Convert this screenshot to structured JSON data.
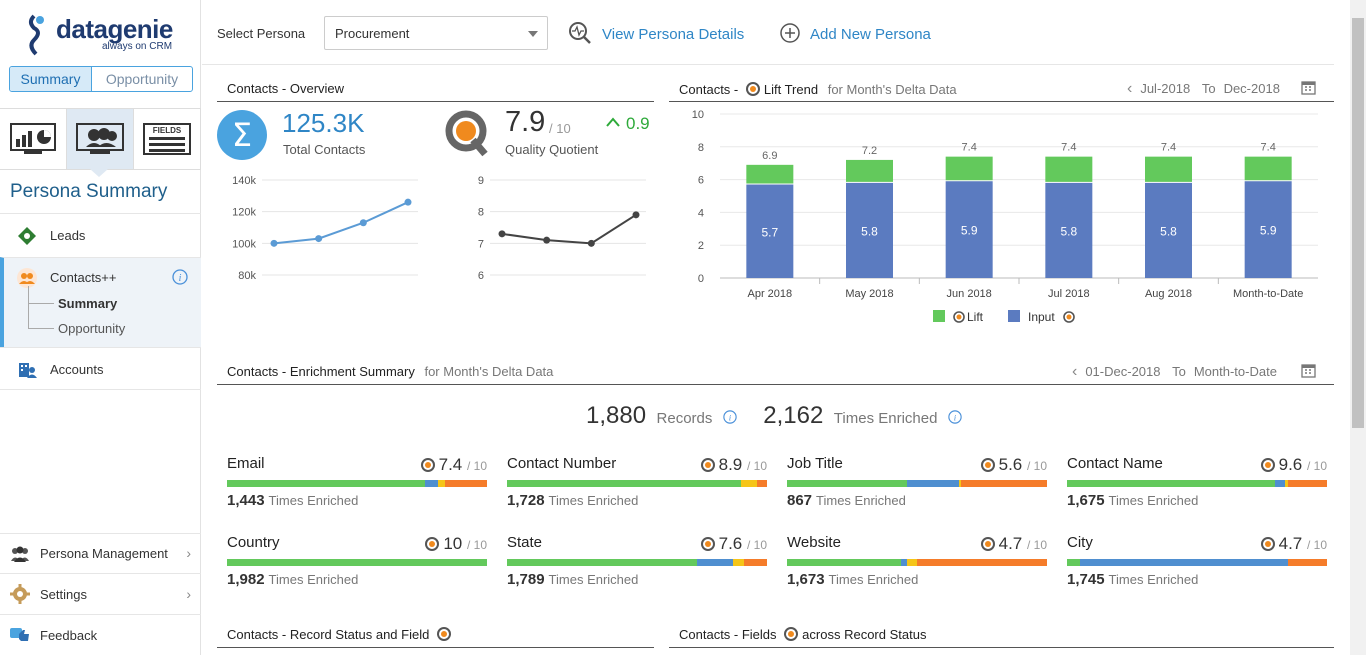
{
  "brand": {
    "name": "datagenie",
    "tagline": "always on CRM"
  },
  "sidebar": {
    "toggle": [
      "Summary",
      "Opportunity"
    ],
    "title": "Persona Summary",
    "items": [
      {
        "label": "Leads"
      },
      {
        "label": "Contacts++",
        "children": [
          "Summary",
          "Opportunity"
        ]
      },
      {
        "label": "Accounts"
      }
    ],
    "bottom": [
      {
        "label": "Persona Management"
      },
      {
        "label": "Settings"
      },
      {
        "label": "Feedback"
      }
    ]
  },
  "header": {
    "select_label": "Select Persona",
    "persona_value": "Procurement",
    "view_details": "View Persona Details",
    "add_persona": "Add New Persona"
  },
  "overview": {
    "title": "Contacts - Overview",
    "total_value": "125.3K",
    "total_label": "Total Contacts",
    "qq_value": "7.9",
    "qq_denom": "/ 10",
    "qq_label": "Quality Quotient",
    "qq_delta": "0.9",
    "contacts_chart": {
      "yticks": [
        "140k",
        "120k",
        "100k",
        "80k"
      ],
      "values": [
        100,
        103,
        113,
        126
      ],
      "ylim": [
        80,
        140
      ]
    },
    "qq_chart": {
      "yticks": [
        "9",
        "8",
        "7",
        "6"
      ],
      "values": [
        7.3,
        7.1,
        7.0,
        7.9
      ],
      "ylim": [
        6,
        9
      ]
    }
  },
  "lift": {
    "title": "Contacts -",
    "title2": "Lift Trend",
    "subtitle": "for Month's Delta Data",
    "from": "Jul-2018",
    "to_word": "To",
    "to": "Dec-2018",
    "legend": [
      "Lift",
      "Input"
    ]
  },
  "chart_data": {
    "type": "bar",
    "categories": [
      "Apr 2018",
      "May 2018",
      "Jun 2018",
      "Jul 2018",
      "Aug 2018",
      "Month-to-Date"
    ],
    "series": [
      {
        "name": "Input",
        "values": [
          5.7,
          5.8,
          5.9,
          5.8,
          5.8,
          5.9
        ]
      },
      {
        "name": "Lift",
        "values": [
          1.2,
          1.4,
          1.5,
          1.6,
          1.6,
          1.5
        ]
      }
    ],
    "totals": [
      "6.9",
      "7.2",
      "7.4",
      "7.4",
      "7.4",
      "7.4"
    ],
    "ylim": [
      0,
      10
    ],
    "yticks": [
      "10",
      "8",
      "6",
      "4",
      "2",
      "0"
    ],
    "colors": {
      "Input": "#5b7bc0",
      "Lift": "#63c95c"
    }
  },
  "enrichment": {
    "title": "Contacts - Enrichment Summary",
    "subtitle": "for Month's Delta Data",
    "from": "01-Dec-2018",
    "to_word": "To",
    "to": "Month-to-Date",
    "records_value": "1,880",
    "records_label": "Records",
    "enriched_value": "2,162",
    "enriched_label": "Times Enriched",
    "times_label": "Times Enriched",
    "fields": [
      {
        "name": "Email",
        "score": "7.4",
        "count": "1,443",
        "segments": [
          0.76,
          0.05,
          0.03,
          0.16
        ]
      },
      {
        "name": "Contact Number",
        "score": "8.9",
        "count": "1,728",
        "segments": [
          0.9,
          0.0,
          0.06,
          0.04
        ]
      },
      {
        "name": "Job Title",
        "score": "5.6",
        "count": "867",
        "segments": [
          0.46,
          0.2,
          0.01,
          0.33
        ]
      },
      {
        "name": "Contact Name",
        "score": "9.6",
        "count": "1,675",
        "segments": [
          0.8,
          0.04,
          0.01,
          0.15
        ]
      },
      {
        "name": "Country",
        "score": "10",
        "count": "1,982",
        "segments": [
          1.0,
          0.0,
          0.0,
          0.0
        ]
      },
      {
        "name": "State",
        "score": "7.6",
        "count": "1,789",
        "segments": [
          0.73,
          0.14,
          0.04,
          0.09
        ]
      },
      {
        "name": "Website",
        "score": "4.7",
        "count": "1,673",
        "segments": [
          0.44,
          0.02,
          0.04,
          0.5
        ]
      },
      {
        "name": "City",
        "score": "4.7",
        "count": "1,745",
        "segments": [
          0.05,
          0.8,
          0.0,
          0.15
        ]
      }
    ],
    "denom": "/ 10",
    "segment_colors": [
      "#63c95c",
      "#4f8fd0",
      "#f5c518",
      "#f57c2a"
    ]
  },
  "bottom_sections": {
    "left": "Contacts - Record Status and Field",
    "right_a": "Contacts - Fields",
    "right_b": "across Record Status"
  }
}
